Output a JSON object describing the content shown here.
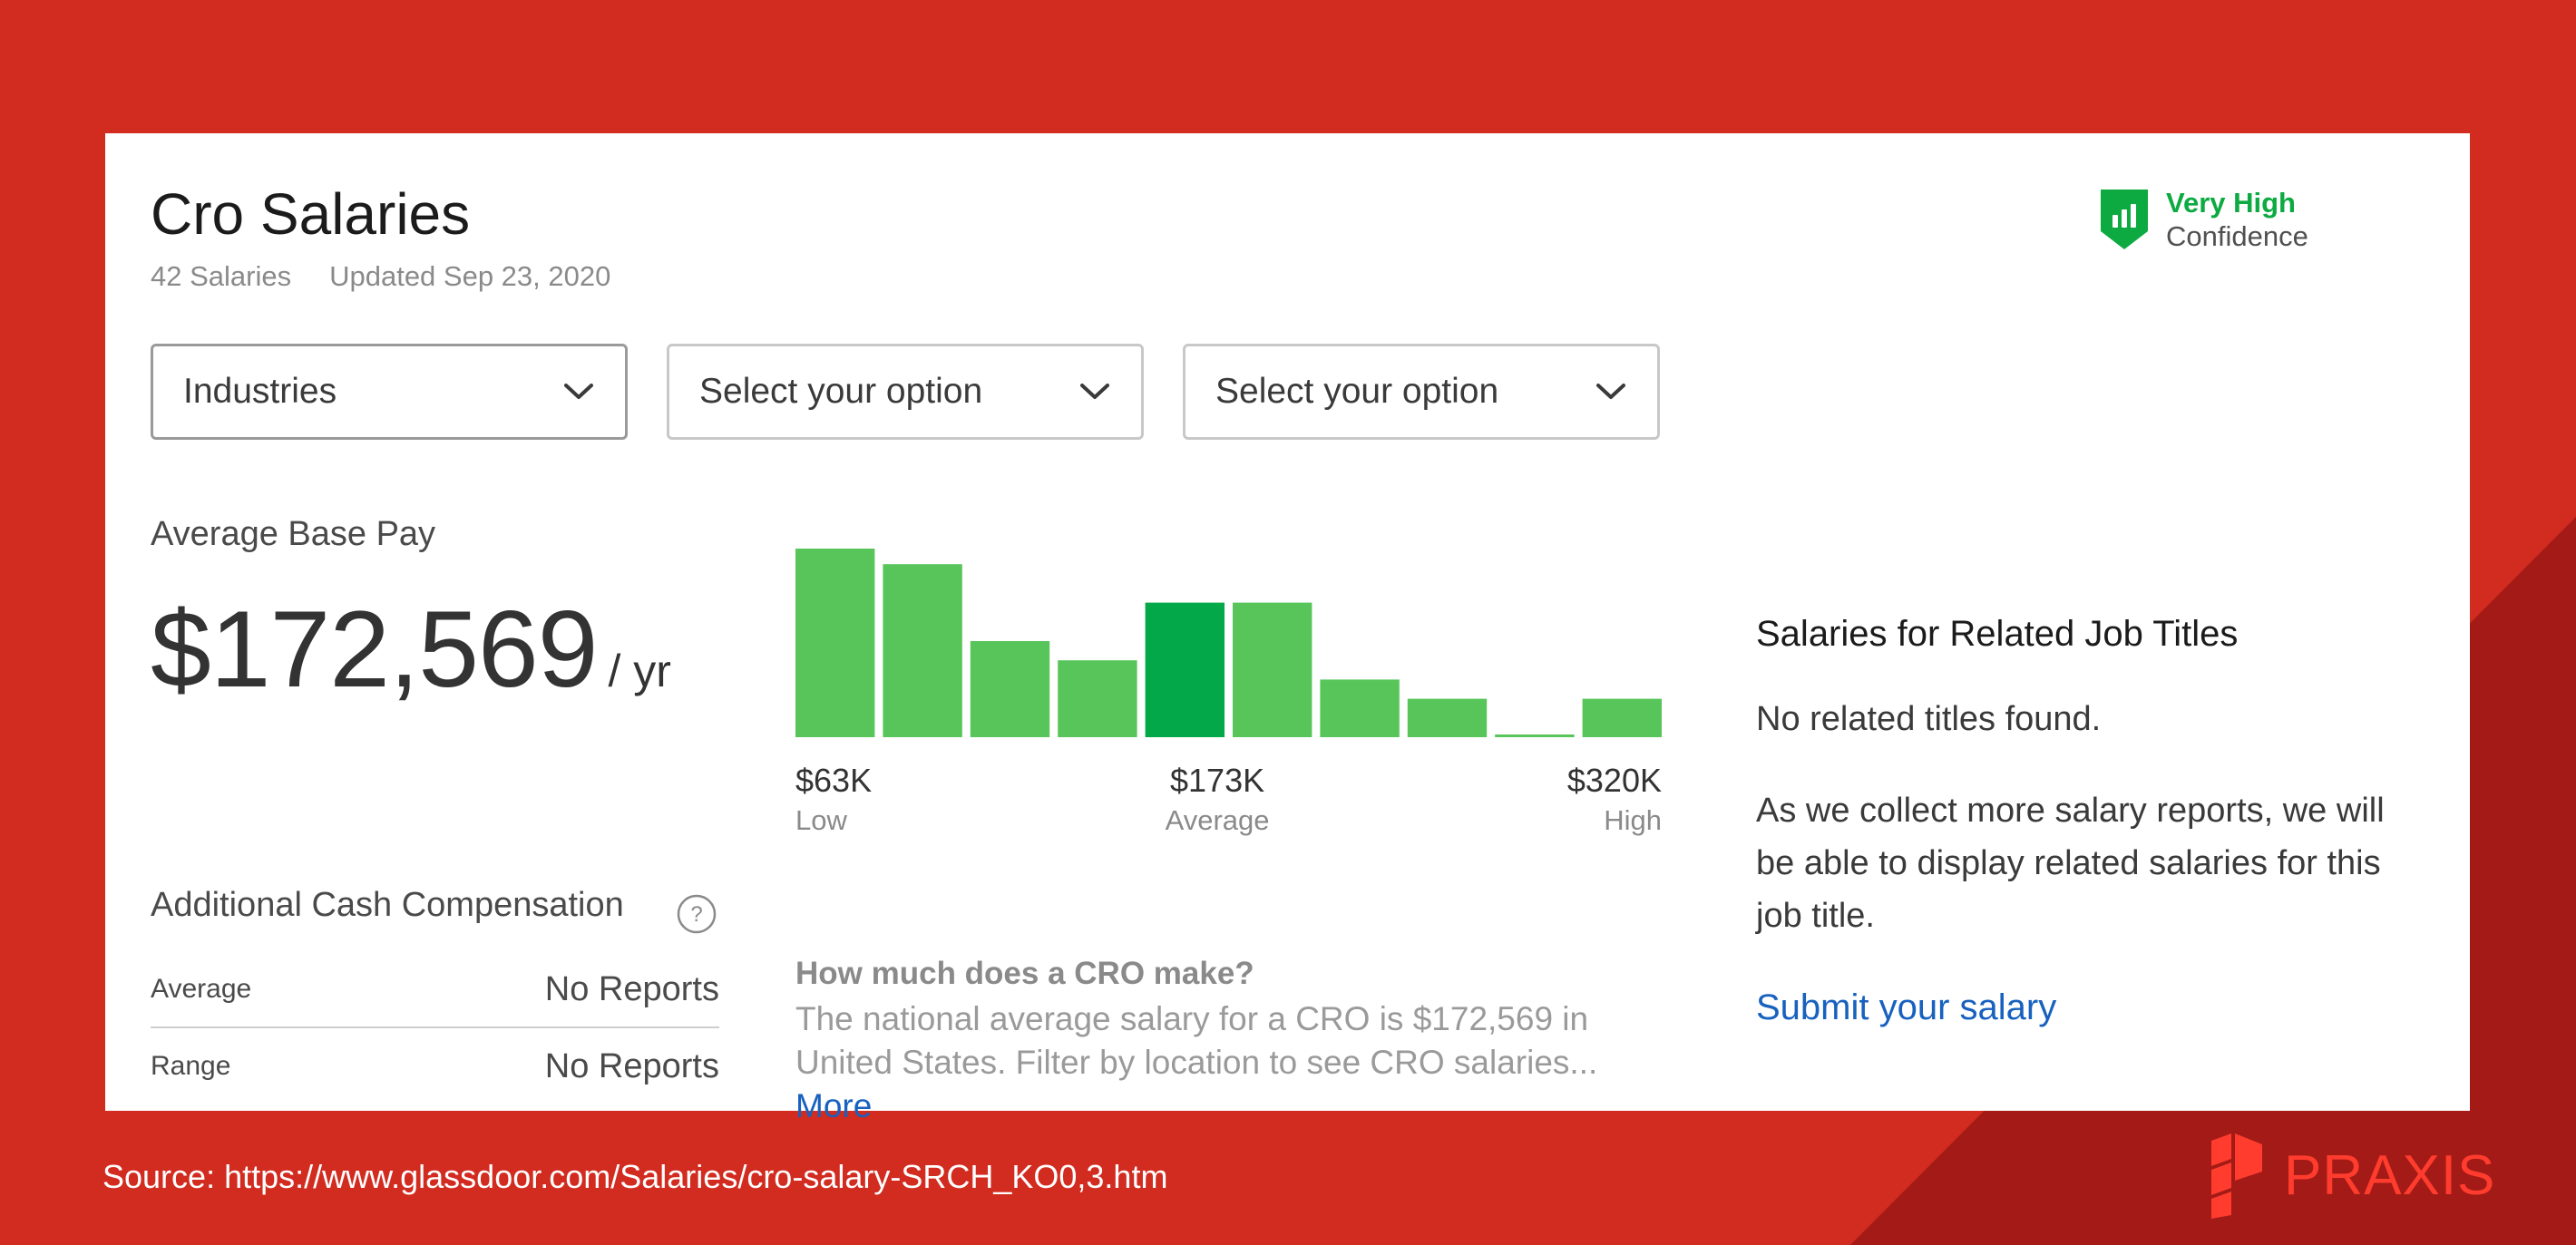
{
  "page": {
    "title": "Cro Salaries",
    "salary_count": "42 Salaries",
    "updated": "Updated Sep 23, 2020"
  },
  "confidence": {
    "level": "Very High",
    "label": "Confidence",
    "icon": "confidence-shield-icon"
  },
  "filters": [
    {
      "label": "Industries",
      "active": true,
      "icon": "chevron-down-icon"
    },
    {
      "label": "Select your option",
      "active": false,
      "icon": "chevron-down-icon"
    },
    {
      "label": "Select your option",
      "active": false,
      "icon": "chevron-down-icon"
    }
  ],
  "base_pay": {
    "label": "Average Base Pay",
    "amount": "$172,569",
    "unit": "/ yr"
  },
  "chart_data": {
    "type": "bar",
    "values": [
      100,
      90,
      50,
      40,
      70,
      70,
      30,
      20,
      1,
      20
    ],
    "highlight_index": 4,
    "ticks": [
      {
        "value": "$63K",
        "label": "Low",
        "align": "start"
      },
      {
        "value": "$173K",
        "label": "Average",
        "align": "middle"
      },
      {
        "value": "$320K",
        "label": "High",
        "align": "end"
      }
    ]
  },
  "additional_cash": {
    "label": "Additional Cash Compensation",
    "help_icon": "help-circle-icon",
    "rows": [
      {
        "key": "Average",
        "value": "No Reports"
      },
      {
        "key": "Range",
        "value": "No Reports"
      }
    ]
  },
  "faq": {
    "question": "How much does a CRO make?",
    "answer": "The national average salary for a CRO is $172,569 in United States. Filter by location to see CRO salaries...",
    "more": "More"
  },
  "related": {
    "title": "Salaries for Related Job Titles",
    "none_found": "No related titles found.",
    "description": "As we collect more salary reports, we will be able to display related salaries for this job title.",
    "submit": "Submit your salary"
  },
  "footer": {
    "source": "Source: https://www.glassdoor.com/Salaries/cro-salary-SRCH_KO0,3.htm",
    "brand": "PRAXIS",
    "brand_icon": "praxis-logo-icon"
  },
  "colors": {
    "background": "#d22b1f",
    "background_dark": "#a31a16",
    "bar": "#58c55a",
    "bar_highlight": "#03a848",
    "confidence_green": "#0caa41",
    "link": "#1861bf",
    "brand": "#ff3c2e"
  }
}
